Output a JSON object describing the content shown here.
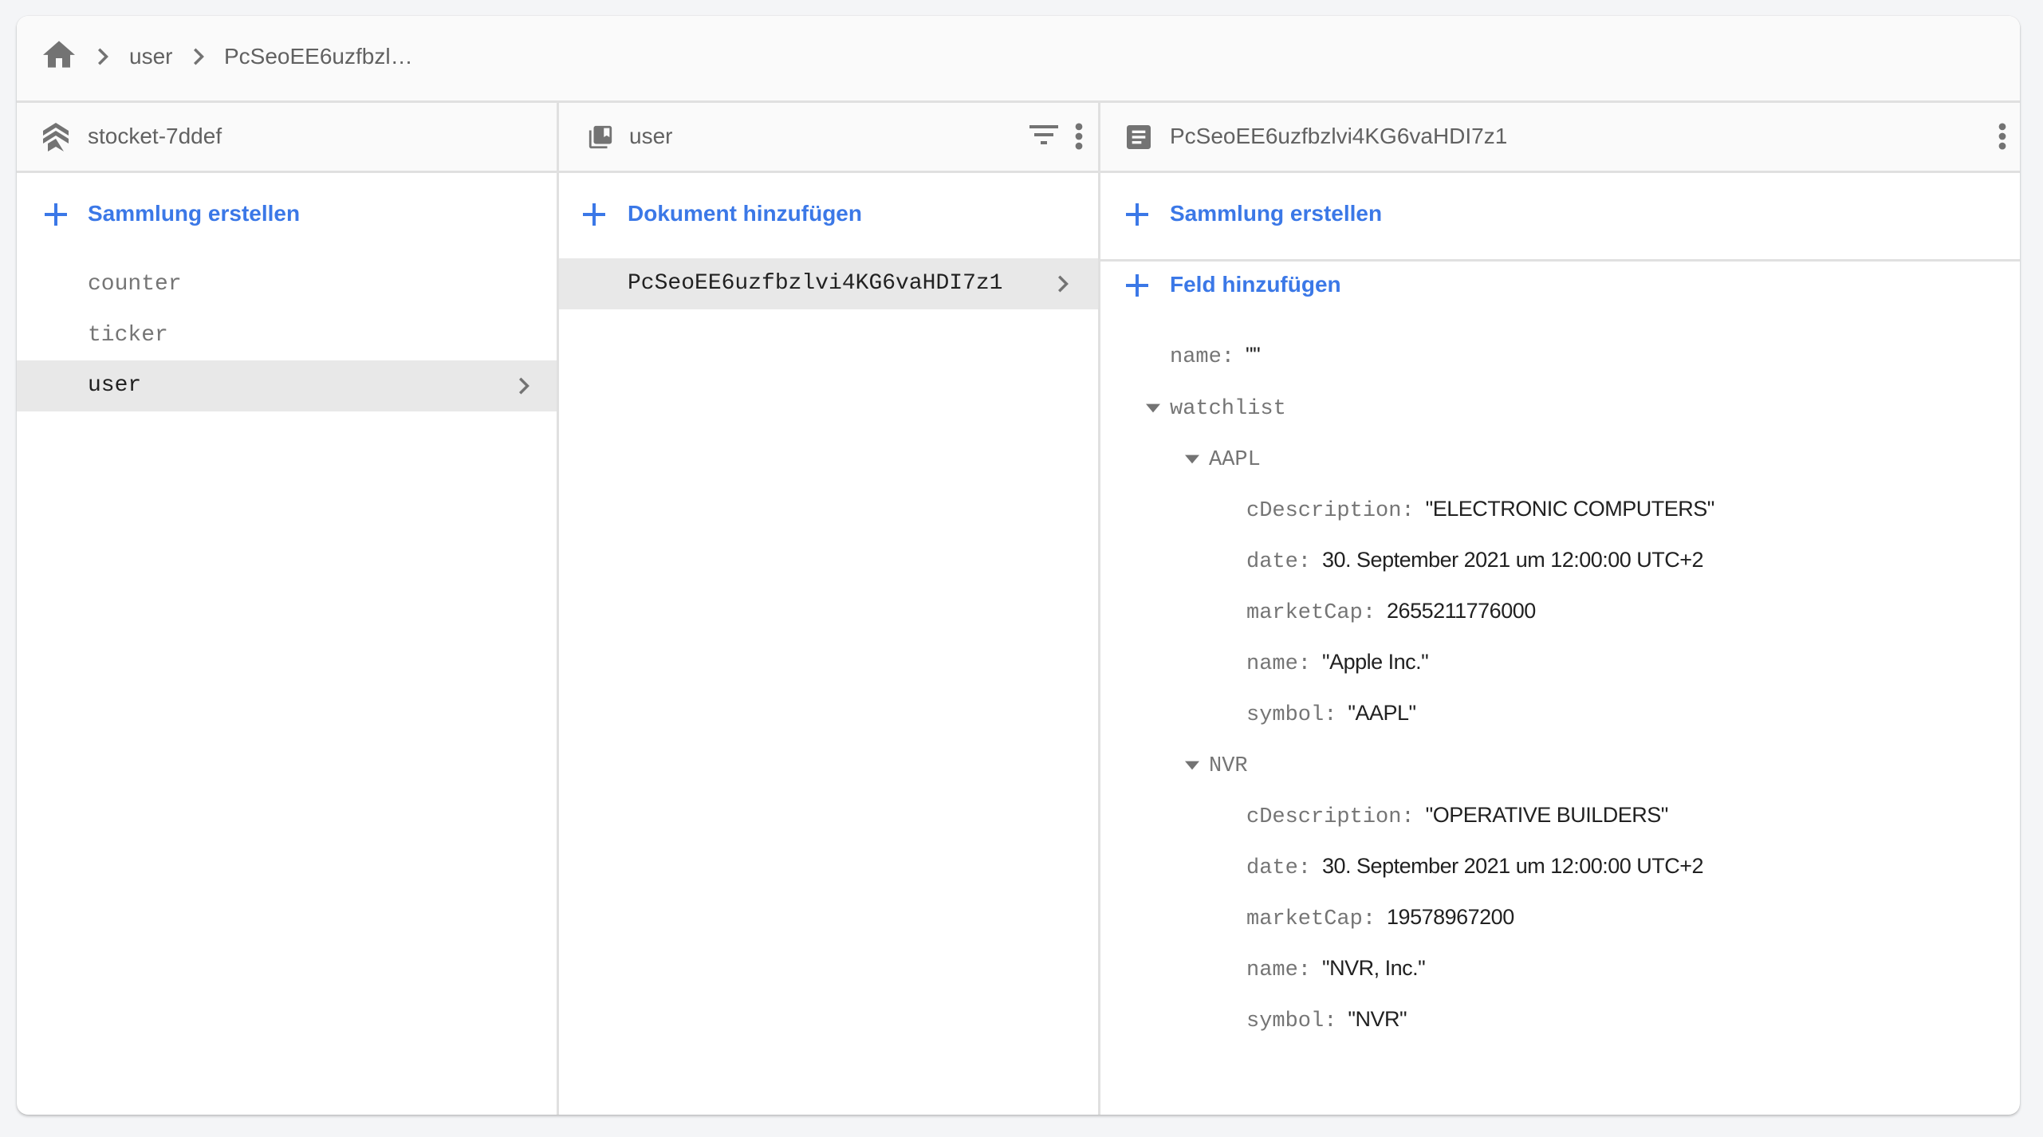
{
  "breadcrumb": {
    "home_icon": "home-icon",
    "items": [
      "user",
      "PcSeoEE6uzfbzl…"
    ]
  },
  "colors": {
    "accent": "#3b78e7",
    "icon_gray": "#737373",
    "selected_row": "#e8e8e8",
    "key_text": "#757575",
    "value_text": "#212121"
  },
  "columns": {
    "root": {
      "icon": "project-stack-icon",
      "title": "stocket-7ddef",
      "action_label": "Sammlung erstellen",
      "items": [
        {
          "label": "counter",
          "selected": false
        },
        {
          "label": "ticker",
          "selected": false
        },
        {
          "label": "user",
          "selected": true
        }
      ]
    },
    "collection": {
      "icon": "collection-icon",
      "title": "user",
      "filter_icon": "filter-icon",
      "menu_icon": "more-vert-icon",
      "action_label": "Dokument hinzufügen",
      "items": [
        {
          "label": "PcSeoEE6uzfbzlvi4KG6vaHDI7z1",
          "selected": true
        }
      ]
    },
    "document": {
      "icon": "document-icon",
      "title": "PcSeoEE6uzfbzlvi4KG6vaHDI7z1",
      "menu_icon": "more-vert-icon",
      "collection_action_label": "Sammlung erstellen",
      "field_action_label": "Feld hinzufügen",
      "fields": {
        "name": {
          "key": "name:",
          "value": "\"\""
        },
        "watchlist": {
          "key": "watchlist",
          "AAPL": {
            "key": "AAPL",
            "cDescription": {
              "key": "cDescription:",
              "value": "\"ELECTRONIC COMPUTERS\""
            },
            "date": {
              "key": "date:",
              "value": "30. September 2021 um 12:00:00 UTC+2"
            },
            "marketCap": {
              "key": "marketCap:",
              "value": "2655211776000"
            },
            "name": {
              "key": "name:",
              "value": "\"Apple Inc.\""
            },
            "symbol": {
              "key": "symbol:",
              "value": "\"AAPL\""
            }
          },
          "NVR": {
            "key": "NVR",
            "cDescription": {
              "key": "cDescription:",
              "value": "\"OPERATIVE BUILDERS\""
            },
            "date": {
              "key": "date:",
              "value": "30. September 2021 um 12:00:00 UTC+2"
            },
            "marketCap": {
              "key": "marketCap:",
              "value": "19578967200"
            },
            "name": {
              "key": "name:",
              "value": "\"NVR, Inc.\""
            },
            "symbol": {
              "key": "symbol:",
              "value": "\"NVR\""
            }
          }
        }
      }
    }
  }
}
